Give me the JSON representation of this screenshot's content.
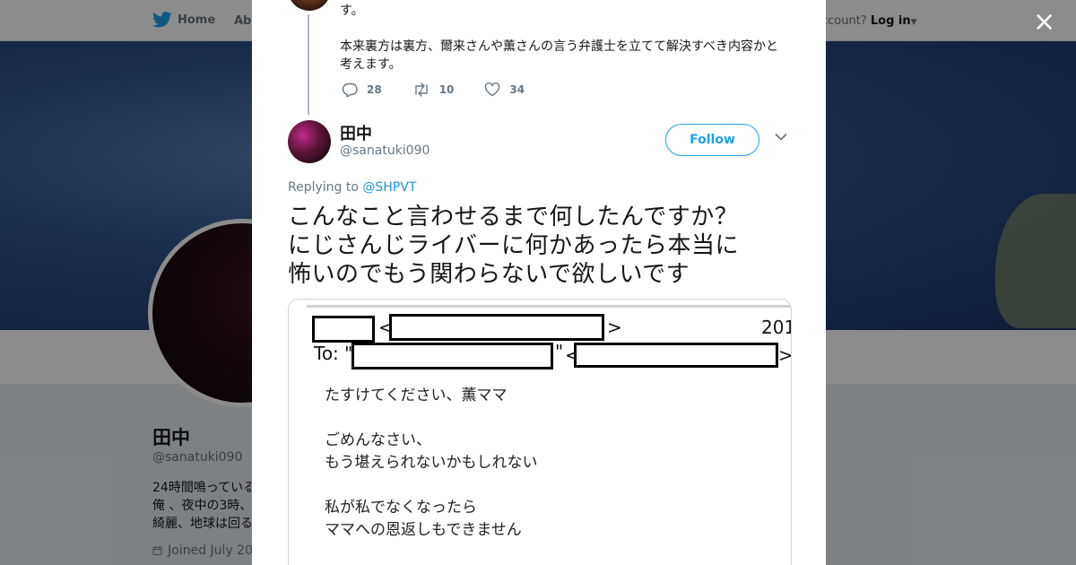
{
  "nav": {
    "home_label": "Home",
    "about_label": "Abo",
    "account_prompt": "ccount?",
    "login_label": "Log in"
  },
  "profile": {
    "name": "田中",
    "handle": "@sanatuki090",
    "bio_lines": [
      "24時間鳴っている",
      "俺 、夜中の3時、",
      "綺麗、地球は回る"
    ],
    "joined": "Joined July 20"
  },
  "modal": {
    "close_label": "×",
    "previous_tweet": {
      "text_lines": [
        "す。",
        "本来裏方は裏方、爾来さんや薫さんの言う弁護士を立てて解決すべき内容かと",
        "考えます。"
      ],
      "replies": "28",
      "retweets": "10",
      "likes": "34"
    },
    "tweet": {
      "author_name": "田中",
      "author_handle": "@sanatuki090",
      "follow_label": "Follow",
      "replying_prefix": "Replying to",
      "replying_to": "@SHPVT",
      "text_lines": [
        "こんなこと言わせるまで何したんですか？",
        "にじさんじライバーに何かあったら本当に",
        "怖いのでもう関わらないで欲しいです"
      ],
      "media": {
        "year": "201",
        "to_label": "To: \"",
        "quote_mark": "\"",
        "bracket_open": "<",
        "bracket_close": ">",
        "lines": [
          "たすけてください、薫ママ",
          "ごめんなさい、",
          "もう堪えられないかもしれない",
          "私が私でなくなったら",
          "ママへの恩返しもできません"
        ]
      }
    }
  },
  "colors": {
    "accent": "#1da1f2",
    "link": "#1b95e0",
    "muted": "#657786"
  }
}
